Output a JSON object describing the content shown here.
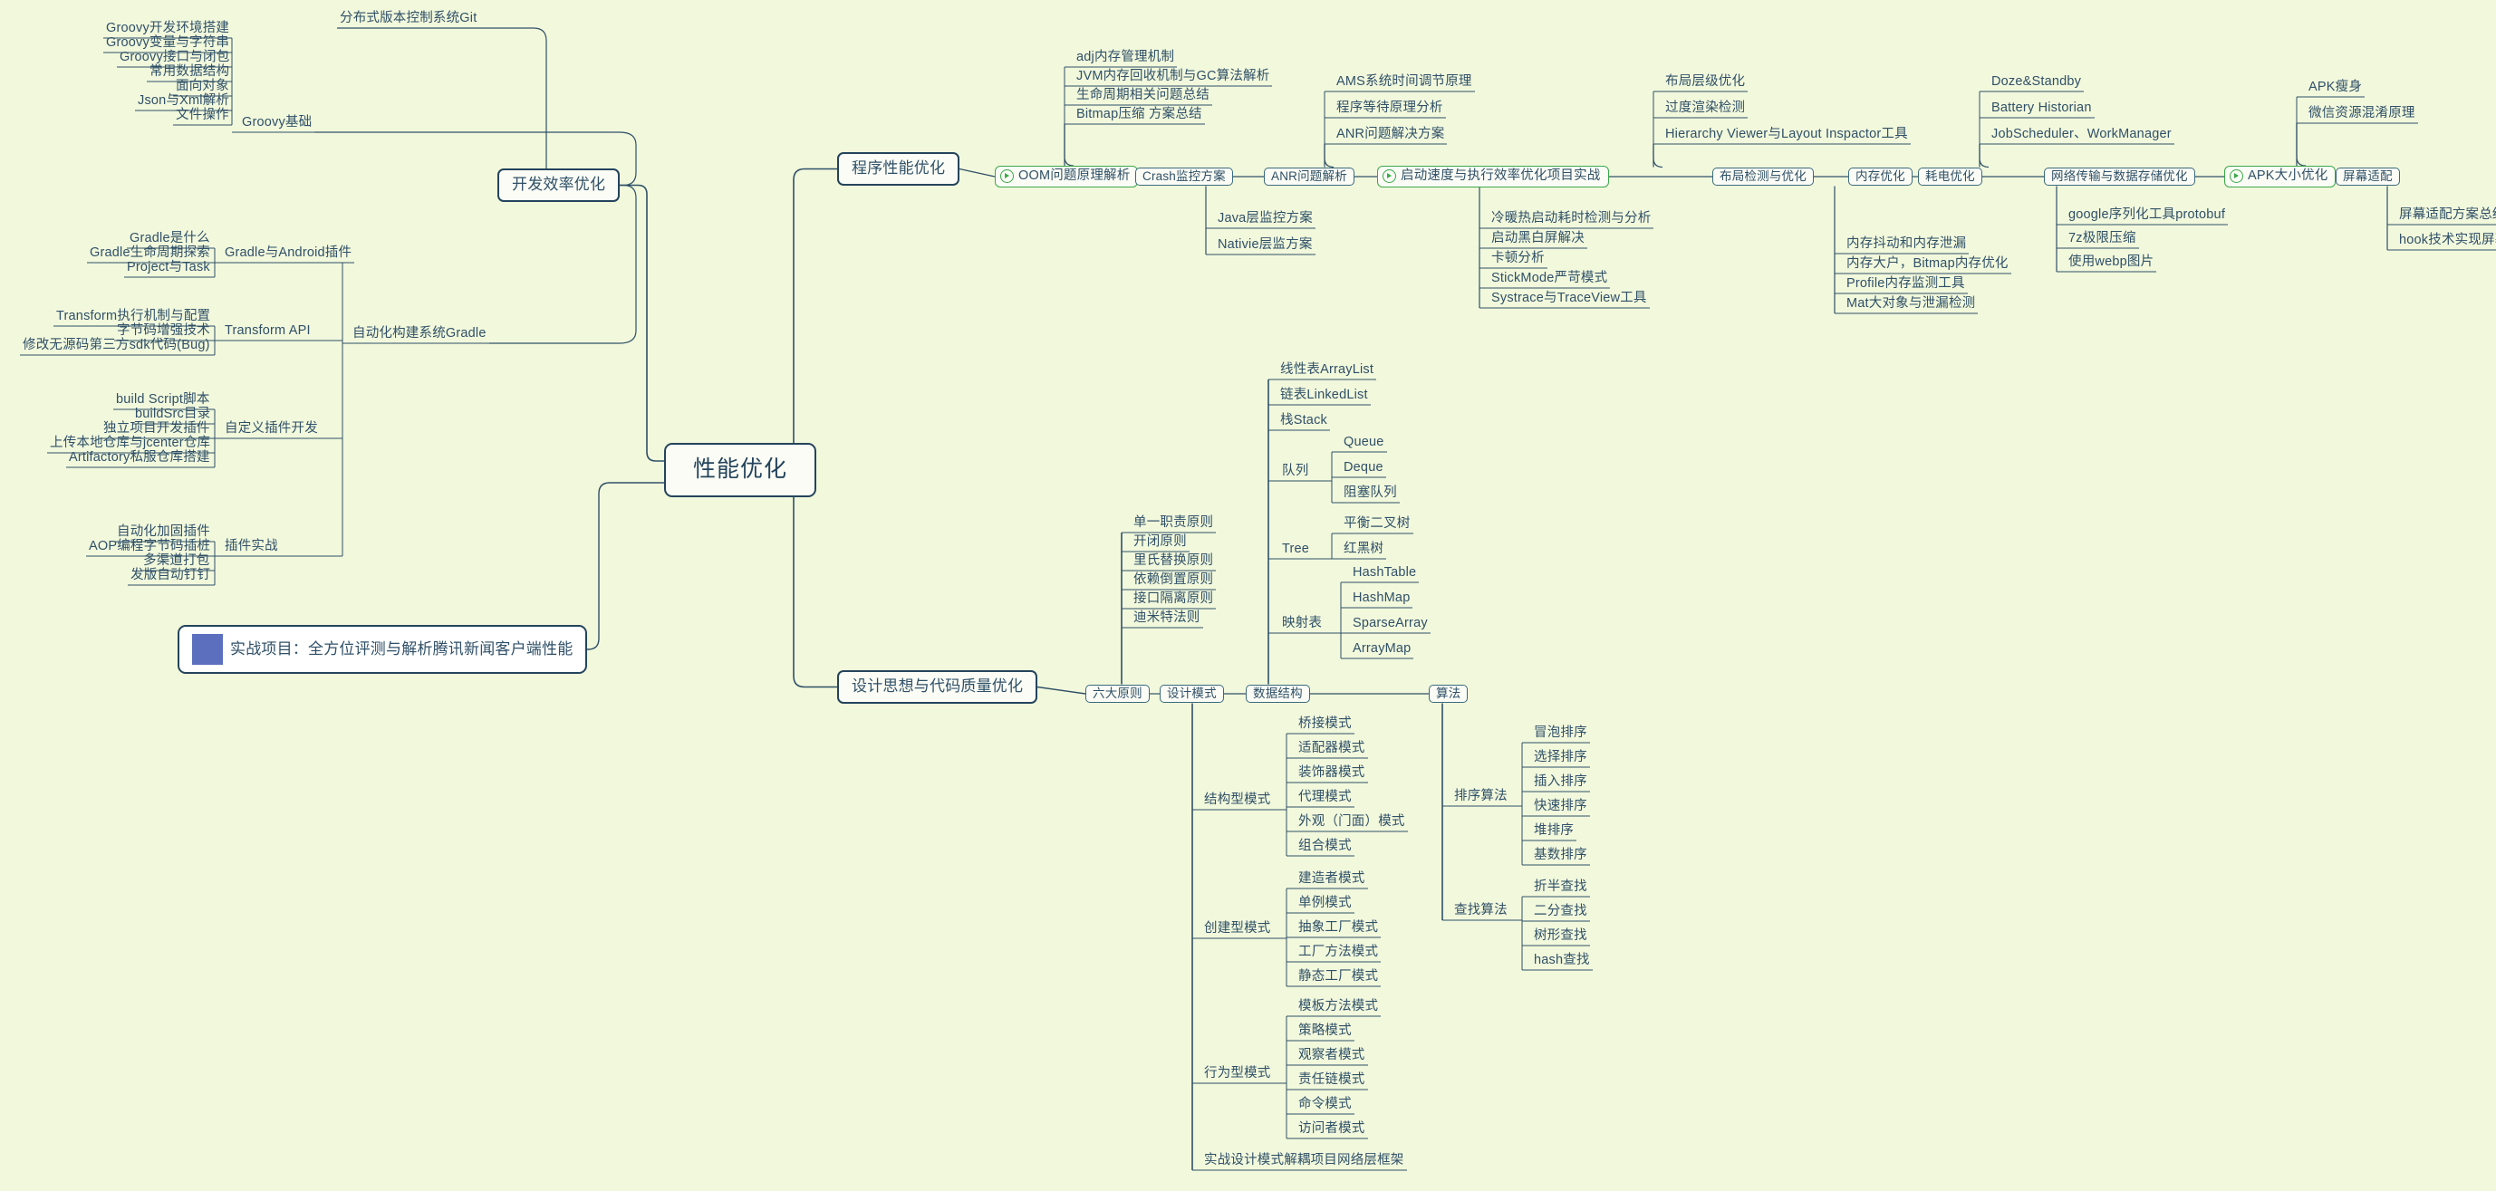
{
  "canvas": {
    "background": "#f2f8dc",
    "line_color": "#2f5068",
    "accent_green": "#3aa94a",
    "root_border": "#24445c"
  },
  "root": {
    "label": "性能优化"
  },
  "project_node": {
    "icon": "rocket-icon",
    "label": "实战项目：全方位评测与解析腾讯新闻客户端性能"
  },
  "branches": [
    {
      "label": "开发效率优化"
    },
    {
      "label": "程序性能优化"
    },
    {
      "label": "设计思想与代码质量优化"
    }
  ],
  "dev_efficiency": {
    "git": "分布式版本控制系统Git",
    "groovy_basics": {
      "label": "Groovy基础",
      "items": [
        "Groovy开发环境搭建",
        "Groovy变量与字符串",
        "Groovy接口与闭包",
        "常用数据结构",
        "面向对象",
        "Json与Xml解析",
        "文件操作"
      ]
    },
    "gradle": {
      "label": "自动化构建系统Gradle",
      "groups": [
        {
          "label": "Gradle与Android插件",
          "items": [
            "Gradle是什么",
            "Gradle生命周期探索",
            "Project与Task"
          ]
        },
        {
          "label": "Transform API",
          "items": [
            "Transform执行机制与配置",
            "字节码增强技术",
            "修改无源码第三方sdk代码(Bug)"
          ]
        },
        {
          "label": "自定义插件开发",
          "items": [
            "build Script脚本",
            "buildSrc目录",
            "独立项目开发插件",
            "上传本地仓库与jcenter仓库",
            "Artifactory私服仓库搭建"
          ]
        },
        {
          "label": "插件实战",
          "items": [
            "自动化加固插件",
            "AOP编程字节码插桩",
            "多渠道打包",
            "发版自动钉钉"
          ]
        }
      ]
    }
  },
  "program_performance": {
    "chain": [
      {
        "label": "OOM问题原理解析",
        "style": "green",
        "icon": "play-icon"
      },
      {
        "label": "Crash监控方案",
        "style": "plain"
      },
      {
        "label": "ANR问题解析",
        "style": "plain"
      },
      {
        "label": "启动速度与执行效率优化项目实战",
        "style": "green",
        "icon": "play-icon"
      },
      {
        "label": "布局检测与优化",
        "style": "plain"
      },
      {
        "label": "内存优化",
        "style": "plain"
      },
      {
        "label": "耗电优化",
        "style": "plain"
      },
      {
        "label": "网络传输与数据存储优化",
        "style": "plain"
      },
      {
        "label": "APK大小优化",
        "style": "green",
        "icon": "play-icon"
      },
      {
        "label": "屏幕适配",
        "style": "plain"
      }
    ],
    "oom_items": [
      "adj内存管理机制",
      "JVM内存回收机制与GC算法解析",
      "生命周期相关问题总结",
      "Bitmap压缩 方案总结"
    ],
    "crash_items": [
      "Java层监控方案",
      "Nativie层监方案"
    ],
    "anr_items": [
      "AMS系统时间调节原理",
      "程序等待原理分析",
      "ANR问题解决方案"
    ],
    "startup_items": [
      "冷暖热启动耗时检测与分析",
      "启动黑白屏解决",
      "卡顿分析",
      "StickMode严苛模式",
      "Systrace与TraceView工具"
    ],
    "layout_items": [
      "布局层级优化",
      "过度渲染检测",
      "Hierarchy Viewer与Layout Inspactor工具"
    ],
    "memory_items": [
      "内存抖动和内存泄漏",
      "内存大户，Bitmap内存优化",
      "Profile内存监测工具",
      "Mat大对象与泄漏检测"
    ],
    "battery_items": [
      "Doze&Standby",
      "Battery Historian",
      "JobScheduler、WorkManager"
    ],
    "network_items": [
      "google序列化工具protobuf",
      "7z极限压缩",
      "使用webp图片"
    ],
    "apk_items": [
      "APK瘦身",
      "微信资源混淆原理"
    ],
    "screen_items": [
      "屏幕适配方案总结",
      "hook技术实现屏幕完全适配"
    ]
  },
  "design_quality": {
    "chain": [
      {
        "label": "六大原则"
      },
      {
        "label": "设计模式"
      },
      {
        "label": "数据结构"
      },
      {
        "label": "算法"
      }
    ],
    "six_principles": [
      "单一职责原则",
      "开闭原则",
      "里氏替换原则",
      "依赖倒置原则",
      "接口隔离原则",
      "迪米特法则"
    ],
    "design_patterns": {
      "structural": {
        "label": "结构型模式",
        "items": [
          "桥接模式",
          "适配器模式",
          "装饰器模式",
          "代理模式",
          "外观（门面）模式",
          "组合模式"
        ]
      },
      "creational": {
        "label": "创建型模式",
        "items": [
          "建造者模式",
          "单例模式",
          "抽象工厂模式",
          "工厂方法模式",
          "静态工厂模式"
        ]
      },
      "behavioral": {
        "label": "行为型模式",
        "items": [
          "模板方法模式",
          "策略模式",
          "观察者模式",
          "责任链模式",
          "命令模式",
          "访问者模式"
        ]
      },
      "practice": "实战设计模式解耦项目网络层框架"
    },
    "data_structures": {
      "flat": [
        "线性表ArrayList",
        "链表LinkedList",
        "栈Stack"
      ],
      "queue": {
        "label": "队列",
        "items": [
          "Queue",
          "Deque",
          "阻塞队列"
        ]
      },
      "tree": {
        "label": "Tree",
        "items": [
          "平衡二叉树",
          "红黑树"
        ]
      },
      "map": {
        "label": "映射表",
        "items": [
          "HashTable",
          "HashMap",
          "SparseArray",
          "ArrayMap"
        ]
      }
    },
    "algorithms": {
      "sorting": {
        "label": "排序算法",
        "items": [
          "冒泡排序",
          "选择排序",
          "插入排序",
          "快速排序",
          "堆排序",
          "基数排序"
        ]
      },
      "searching": {
        "label": "查找算法",
        "items": [
          "折半查找",
          "二分查找",
          "树形查找",
          "hash查找"
        ]
      }
    }
  }
}
